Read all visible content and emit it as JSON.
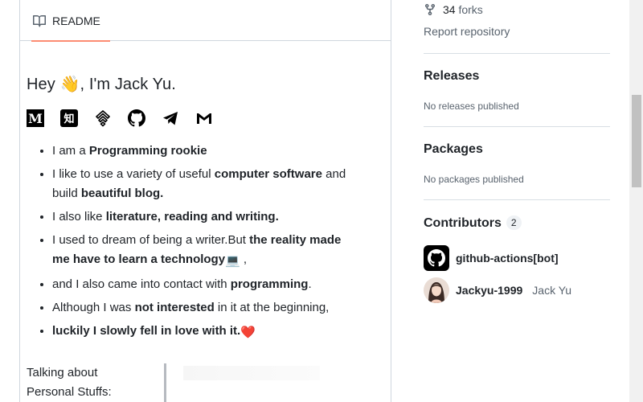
{
  "readme": {
    "tab_label": "README",
    "heading": "Hey 👋, I'm Jack Yu.",
    "socials": [
      "medium-icon",
      "zhihu-icon",
      "juejin-icon",
      "github-icon",
      "telegram-icon",
      "gmail-icon"
    ],
    "bullets": [
      {
        "parts": [
          [
            "I am a ",
            false
          ],
          [
            "Programming rookie",
            true
          ]
        ]
      },
      {
        "parts": [
          [
            "I like to use a variety of useful ",
            false
          ],
          [
            "computer software",
            true
          ],
          [
            " and build ",
            false
          ],
          [
            "beautiful blog.",
            true
          ]
        ]
      },
      {
        "parts": [
          [
            "I also like ",
            false
          ],
          [
            "literature, reading and writing.",
            true
          ]
        ]
      },
      {
        "parts": [
          [
            "I used to dream of being a writer.But ",
            false
          ],
          [
            "the reality made me have to learn a technology",
            true
          ],
          [
            "💻",
            false
          ],
          [
            " ,",
            false
          ]
        ]
      },
      {
        "parts": [
          [
            "and I also came into contact with ",
            false
          ],
          [
            "programming",
            true
          ],
          [
            ".",
            false
          ]
        ]
      },
      {
        "parts": [
          [
            "Although I was ",
            false
          ],
          [
            "not interested",
            true
          ],
          [
            " in it at the beginning,",
            false
          ]
        ]
      },
      {
        "parts": [
          [
            "luckily I slowly fell in love with it.",
            true
          ],
          [
            " ❤️",
            false
          ]
        ]
      }
    ],
    "talking_about": "Talking about Personal Stuffs:"
  },
  "sidebar": {
    "forks_count": "34",
    "forks_label": "forks",
    "report": "Report repository",
    "releases_title": "Releases",
    "releases_sub": "No releases published",
    "packages_title": "Packages",
    "packages_sub": "No packages published",
    "contributors_title": "Contributors",
    "contributors_count": "2",
    "contributors": [
      {
        "login": "github-actions[bot]",
        "name": ""
      },
      {
        "login": "Jackyu-1999",
        "name": "Jack Yu"
      }
    ]
  },
  "colors": {
    "tab_underline": "#fd8c73",
    "heart": "#e5243b"
  }
}
